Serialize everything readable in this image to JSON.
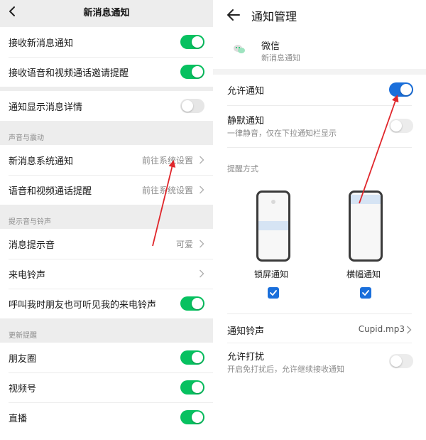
{
  "left": {
    "title": "新消息通知",
    "rows_top": [
      {
        "label": "接收新消息通知",
        "toggle": "on"
      },
      {
        "label": "接收语音和视频通话邀请提醒",
        "toggle": "on"
      }
    ],
    "row_detail": {
      "label": "通知显示消息详情",
      "toggle": "off"
    },
    "section_sound": "声音与震动",
    "sound_rows": [
      {
        "label": "新消息系统通知",
        "value": "前往系统设置"
      },
      {
        "label": "语音和视频通话提醒",
        "value": "前往系统设置"
      }
    ],
    "section_tone": "提示音与铃声",
    "tone_rows": [
      {
        "label": "消息提示音",
        "value": "可爱"
      },
      {
        "label": "来电铃声",
        "value": ""
      }
    ],
    "ringtone_visible_row": {
      "label": "呼叫我时朋友也可听见我的来电铃声",
      "toggle": "on"
    },
    "section_update": "更新提醒",
    "update_rows": [
      {
        "label": "朋友圈",
        "toggle": "on"
      },
      {
        "label": "视频号",
        "toggle": "on"
      },
      {
        "label": "直播",
        "toggle": "on"
      }
    ]
  },
  "right": {
    "title": "通知管理",
    "app_name": "微信",
    "app_sub": "新消息通知",
    "allow_label": "允许通知",
    "allow_state": "on",
    "silent_label": "静默通知",
    "silent_sub": "一律静音，仅在下拉通知栏显示",
    "silent_state": "off",
    "remind_section": "提醒方式",
    "lock_label": "锁屏通知",
    "lock_checked": true,
    "banner_label": "横幅通知",
    "banner_checked": true,
    "ringtone_label": "通知铃声",
    "ringtone_value": "Cupid.mp3",
    "dnd_label": "允许打扰",
    "dnd_sub": "开启免打扰后，允许继续接收通知",
    "dnd_state": "off"
  },
  "colors": {
    "wechat_green": "#07c160",
    "toggle_blue": "#1a6fdb",
    "annotation_red": "#e0262b",
    "page_gray": "#ededed"
  },
  "icons": [
    "back-chevron-icon",
    "chevron-right-icon",
    "wechat-app-icon",
    "checkmark-icon",
    "arrow-left-icon"
  ]
}
